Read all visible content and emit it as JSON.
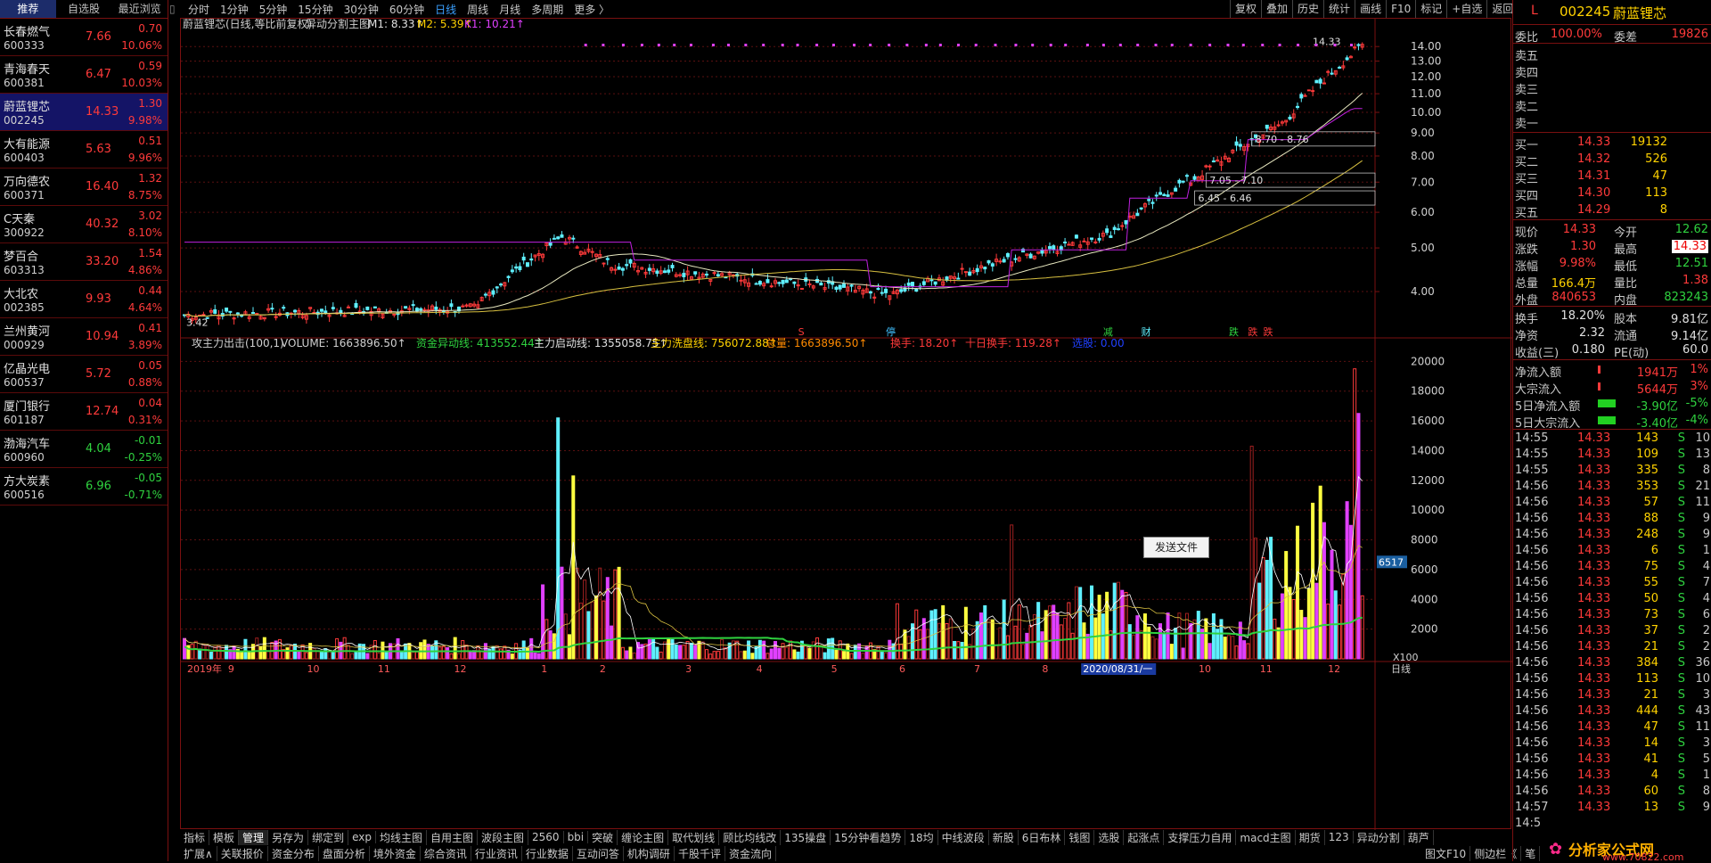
{
  "left_tabs": [
    "推荐",
    "自选股",
    "最近浏览"
  ],
  "watchlist": [
    {
      "name": "长春燃气",
      "code": "600333",
      "price": "7.66",
      "chg": "0.70",
      "pct": "10.06%",
      "dir": "up"
    },
    {
      "name": "青海春天",
      "code": "600381",
      "price": "6.47",
      "chg": "0.59",
      "pct": "10.03%",
      "dir": "up"
    },
    {
      "name": "蔚蓝锂芯",
      "code": "002245",
      "price": "14.33",
      "chg": "1.30",
      "pct": "9.98%",
      "dir": "up",
      "selected": true
    },
    {
      "name": "大有能源",
      "code": "600403",
      "price": "5.63",
      "chg": "0.51",
      "pct": "9.96%",
      "dir": "up"
    },
    {
      "name": "万向德农",
      "code": "600371",
      "price": "16.40",
      "chg": "1.32",
      "pct": "8.75%",
      "dir": "up"
    },
    {
      "name": "C天秦",
      "code": "300922",
      "price": "40.32",
      "chg": "3.02",
      "pct": "8.10%",
      "dir": "up"
    },
    {
      "name": "梦百合",
      "code": "603313",
      "price": "33.20",
      "chg": "1.54",
      "pct": "4.86%",
      "dir": "up"
    },
    {
      "name": "大北农",
      "code": "002385",
      "price": "9.93",
      "chg": "0.44",
      "pct": "4.64%",
      "dir": "up"
    },
    {
      "name": "兰州黄河",
      "code": "000929",
      "price": "10.94",
      "chg": "0.41",
      "pct": "3.89%",
      "dir": "up"
    },
    {
      "name": "亿晶光电",
      "code": "600537",
      "price": "5.72",
      "chg": "0.05",
      "pct": "0.88%",
      "dir": "up"
    },
    {
      "name": "厦门银行",
      "code": "601187",
      "price": "12.74",
      "chg": "0.04",
      "pct": "0.31%",
      "dir": "up"
    },
    {
      "name": "渤海汽车",
      "code": "600960",
      "price": "4.04",
      "chg": "-0.01",
      "pct": "-0.25%",
      "dir": "dn"
    },
    {
      "name": "方大炭素",
      "code": "600516",
      "price": "6.96",
      "chg": "-0.05",
      "pct": "-0.71%",
      "dir": "dn"
    }
  ],
  "timeframes": [
    "分时",
    "1分钟",
    "5分钟",
    "15分钟",
    "30分钟",
    "60分钟",
    "日线",
    "周线",
    "月线",
    "多周期",
    "更多 〉"
  ],
  "active_timeframe": "日线",
  "top_right_buttons": [
    "复权",
    "叠加",
    "历史",
    "统计",
    "画线",
    "F10",
    "标记",
    "+自选",
    "返回"
  ],
  "main_chart": {
    "title": "蔚蓝锂芯(日线,等比前复权)",
    "indicator": "异动分割主图",
    "m1": "M1: 8.33↑",
    "m2": "M2: 5.39↑",
    "k1": "K1: 10.21↑",
    "price_ticks": [
      "14.00",
      "13.00",
      "12.00",
      "11.00",
      "10.00",
      "9.00",
      "8.00",
      "7.00",
      "6.00",
      "5.00",
      "4.00"
    ],
    "low_label": "3.42",
    "high_label": "14.33",
    "zone_labels": [
      "8.70 - 8.76",
      "7.05 - 7.10",
      "6.45 - 6.46"
    ],
    "event_markers": [
      "S",
      "停",
      "减",
      "财",
      "跌",
      "跌",
      "跌"
    ]
  },
  "sub_chart": {
    "title": "攻主力出击(100,1)",
    "volume": "VOLUME: 1663896.50↑",
    "fund1": "资金异动线: 413552.44↑",
    "fund2": "主力启动线: 1355058.75↑",
    "fund3": "主力洗盘线: 756072.88↑",
    "total": "总量: 1663896.50↑",
    "turnover": "换手: 18.20↑",
    "turnover10": "十日换手: 119.28↑",
    "select": "选股: 0.00",
    "vol_ticks": [
      "20000",
      "18000",
      "16000",
      "14000",
      "12000",
      "10000",
      "8000",
      "6000",
      "4000",
      "2000"
    ],
    "vol_current": "6517",
    "unit": "X100"
  },
  "x_axis": {
    "labels": [
      "2019年",
      "9",
      "10",
      "11",
      "12",
      "1",
      "2",
      "3",
      "4",
      "5",
      "6",
      "7",
      "8",
      "2020/08/31/一",
      "10",
      "11",
      "12"
    ],
    "right": "日线"
  },
  "tooltip": "发送文件",
  "bottom_row1": [
    "指标",
    "模板",
    "管理",
    "另存为",
    "绑定到",
    "exp",
    "均线主图",
    "自用主图",
    "波段主图",
    "2560",
    "bbi",
    "突破",
    "缠论主图",
    "取代划线",
    "顾比均线改",
    "135操盘",
    "15分钟看趋势",
    "18均",
    "中线波段",
    "新股",
    "6日布林",
    "钱图",
    "选股",
    "起涨点",
    "支撑压力自用",
    "macd主图",
    "期货",
    "123",
    "异动分割",
    "葫芦"
  ],
  "bottom_row1_active": "管理",
  "bottom_row2": [
    "扩展∧",
    "关联报价",
    "资金分布",
    "盘面分析",
    "境外资金",
    "综合资讯",
    "行业资讯",
    "行业数据",
    "互动问答",
    "机构调研",
    "千股千评",
    "资金流向"
  ],
  "bottom_row2_right": [
    "图文F10",
    "侧边栏《",
    "笔"
  ],
  "quote": {
    "code": "002245",
    "name": "蔚蓝锂芯",
    "flag": "L",
    "weibi_label": "委比",
    "weibi": "100.00%",
    "weicha_label": "委差",
    "weicha": "19826",
    "asks": [
      {
        "label": "卖五"
      },
      {
        "label": "卖四"
      },
      {
        "label": "卖三"
      },
      {
        "label": "卖二"
      },
      {
        "label": "卖一"
      }
    ],
    "bids": [
      {
        "label": "买一",
        "price": "14.33",
        "vol": "19132"
      },
      {
        "label": "买二",
        "price": "14.32",
        "vol": "526"
      },
      {
        "label": "买三",
        "price": "14.31",
        "vol": "47"
      },
      {
        "label": "买四",
        "price": "14.30",
        "vol": "113"
      },
      {
        "label": "买五",
        "price": "14.29",
        "vol": "8"
      }
    ],
    "stats": [
      [
        "现价",
        "14.33",
        "今开",
        "12.62"
      ],
      [
        "涨跌",
        "1.30",
        "最高",
        "14.33"
      ],
      [
        "涨幅",
        "9.98%",
        "最低",
        "12.51"
      ],
      [
        "总量",
        "166.4万",
        "量比",
        "1.38"
      ],
      [
        "外盘",
        "840653",
        "内盘",
        "823243"
      ]
    ],
    "fin": [
      [
        "换手",
        "18.20%",
        "股本",
        "9.81亿"
      ],
      [
        "净资",
        "2.32",
        "流通",
        "9.14亿"
      ],
      [
        "收益(三)",
        "0.180",
        "PE(动)",
        "60.0"
      ]
    ],
    "flows": [
      {
        "label": "净流入额",
        "value": "1941万",
        "pct": "1%",
        "dir": "up"
      },
      {
        "label": "大宗流入",
        "value": "5644万",
        "pct": "3%",
        "dir": "up"
      },
      {
        "label": "5日净流入额",
        "value": "-3.90亿",
        "pct": "-5%",
        "dir": "dn"
      },
      {
        "label": "5日大宗流入",
        "value": "-3.40亿",
        "pct": "-4%",
        "dir": "dn"
      }
    ],
    "ticks": [
      [
        "14:55",
        "14.33",
        "143",
        "S",
        "10"
      ],
      [
        "14:55",
        "14.33",
        "109",
        "S",
        "13"
      ],
      [
        "14:55",
        "14.33",
        "335",
        "S",
        "8"
      ],
      [
        "14:56",
        "14.33",
        "353",
        "S",
        "21"
      ],
      [
        "14:56",
        "14.33",
        "57",
        "S",
        "11"
      ],
      [
        "14:56",
        "14.33",
        "88",
        "S",
        "9"
      ],
      [
        "14:56",
        "14.33",
        "248",
        "S",
        "9"
      ],
      [
        "14:56",
        "14.33",
        "6",
        "S",
        "1"
      ],
      [
        "14:56",
        "14.33",
        "75",
        "S",
        "4"
      ],
      [
        "14:56",
        "14.33",
        "55",
        "S",
        "7"
      ],
      [
        "14:56",
        "14.33",
        "50",
        "S",
        "4"
      ],
      [
        "14:56",
        "14.33",
        "73",
        "S",
        "6"
      ],
      [
        "14:56",
        "14.33",
        "37",
        "S",
        "2"
      ],
      [
        "14:56",
        "14.33",
        "21",
        "S",
        "2"
      ],
      [
        "14:56",
        "14.33",
        "384",
        "S",
        "36"
      ],
      [
        "14:56",
        "14.33",
        "113",
        "S",
        "10"
      ],
      [
        "14:56",
        "14.33",
        "21",
        "S",
        "3"
      ],
      [
        "14:56",
        "14.33",
        "444",
        "S",
        "43"
      ],
      [
        "14:56",
        "14.33",
        "47",
        "S",
        "11"
      ],
      [
        "14:56",
        "14.33",
        "14",
        "S",
        "3"
      ],
      [
        "14:56",
        "14.33",
        "41",
        "S",
        "5"
      ],
      [
        "14:56",
        "14.33",
        "4",
        "S",
        "1"
      ],
      [
        "14:56",
        "14.33",
        "60",
        "S",
        "8"
      ],
      [
        "14:57",
        "14.33",
        "13",
        "S",
        "9"
      ],
      [
        "14:5",
        "",
        "",
        "",
        ""
      ]
    ],
    "watermark": "分析家公式网",
    "watermark_url": "www.70822.com"
  }
}
